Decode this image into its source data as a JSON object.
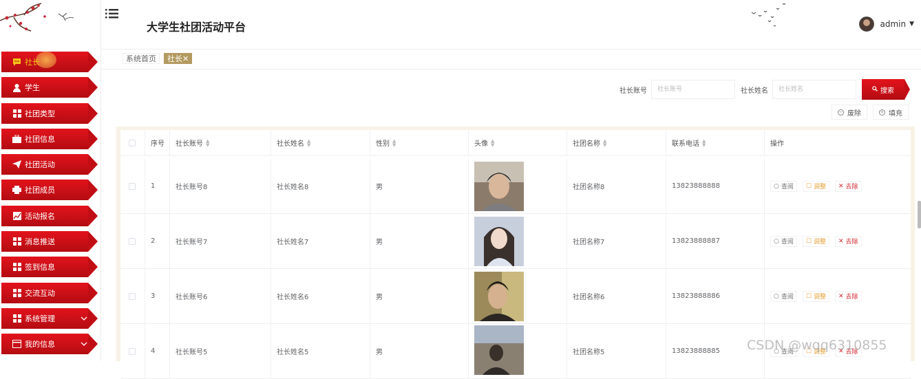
{
  "header": {
    "title": "大学生社团活动平台",
    "username": "admin"
  },
  "sidebar": {
    "items": [
      {
        "label": "社长",
        "icon": "chat-icon",
        "active": true
      },
      {
        "label": "学生",
        "icon": "user-icon"
      },
      {
        "label": "社团类型",
        "icon": "grid-icon"
      },
      {
        "label": "社团信息",
        "icon": "briefcase-icon"
      },
      {
        "label": "社团活动",
        "icon": "send-icon"
      },
      {
        "label": "社团成员",
        "icon": "printer-icon"
      },
      {
        "label": "活动报名",
        "icon": "chart-icon"
      },
      {
        "label": "消息推送",
        "icon": "grid-icon"
      },
      {
        "label": "签到信息",
        "icon": "grid-icon"
      },
      {
        "label": "交流互动",
        "icon": "grid-icon"
      },
      {
        "label": "系统管理",
        "icon": "grid-icon",
        "expandable": true
      },
      {
        "label": "我的信息",
        "icon": "card-icon",
        "expandable": true
      }
    ]
  },
  "tabs": [
    {
      "label": "系统首页"
    },
    {
      "label": "社长✕",
      "active": true
    }
  ],
  "search": {
    "account_label": "社长账号",
    "account_placeholder": "社长账号",
    "name_label": "社长姓名",
    "name_placeholder": "社长姓名",
    "button": "搜索"
  },
  "actions": {
    "delete": "废除",
    "add": "填充"
  },
  "table": {
    "columns": [
      "序号",
      "社长账号",
      "社长姓名",
      "性别",
      "头像",
      "社团名称",
      "联系电话",
      "操作"
    ],
    "op_view": "查阅",
    "op_edit": "调整",
    "op_delete": "去除",
    "rows": [
      {
        "index": "1",
        "account": "社长账号8",
        "name": "社长姓名8",
        "gender": "男",
        "club": "社团名称8",
        "phone": "13823888888"
      },
      {
        "index": "2",
        "account": "社长账号7",
        "name": "社长姓名7",
        "gender": "男",
        "club": "社团名称7",
        "phone": "13823888887"
      },
      {
        "index": "3",
        "account": "社长账号6",
        "name": "社长姓名6",
        "gender": "男",
        "club": "社团名称6",
        "phone": "13823888886"
      },
      {
        "index": "4",
        "account": "社长账号5",
        "name": "社长姓名5",
        "gender": "男",
        "club": "社团名称5",
        "phone": "13823888885"
      }
    ]
  },
  "watermark": "CSDN @wqq6310855",
  "colors": {
    "primary": "#d2151b",
    "accent": "#b49a60",
    "active_text": "#f5c518"
  }
}
